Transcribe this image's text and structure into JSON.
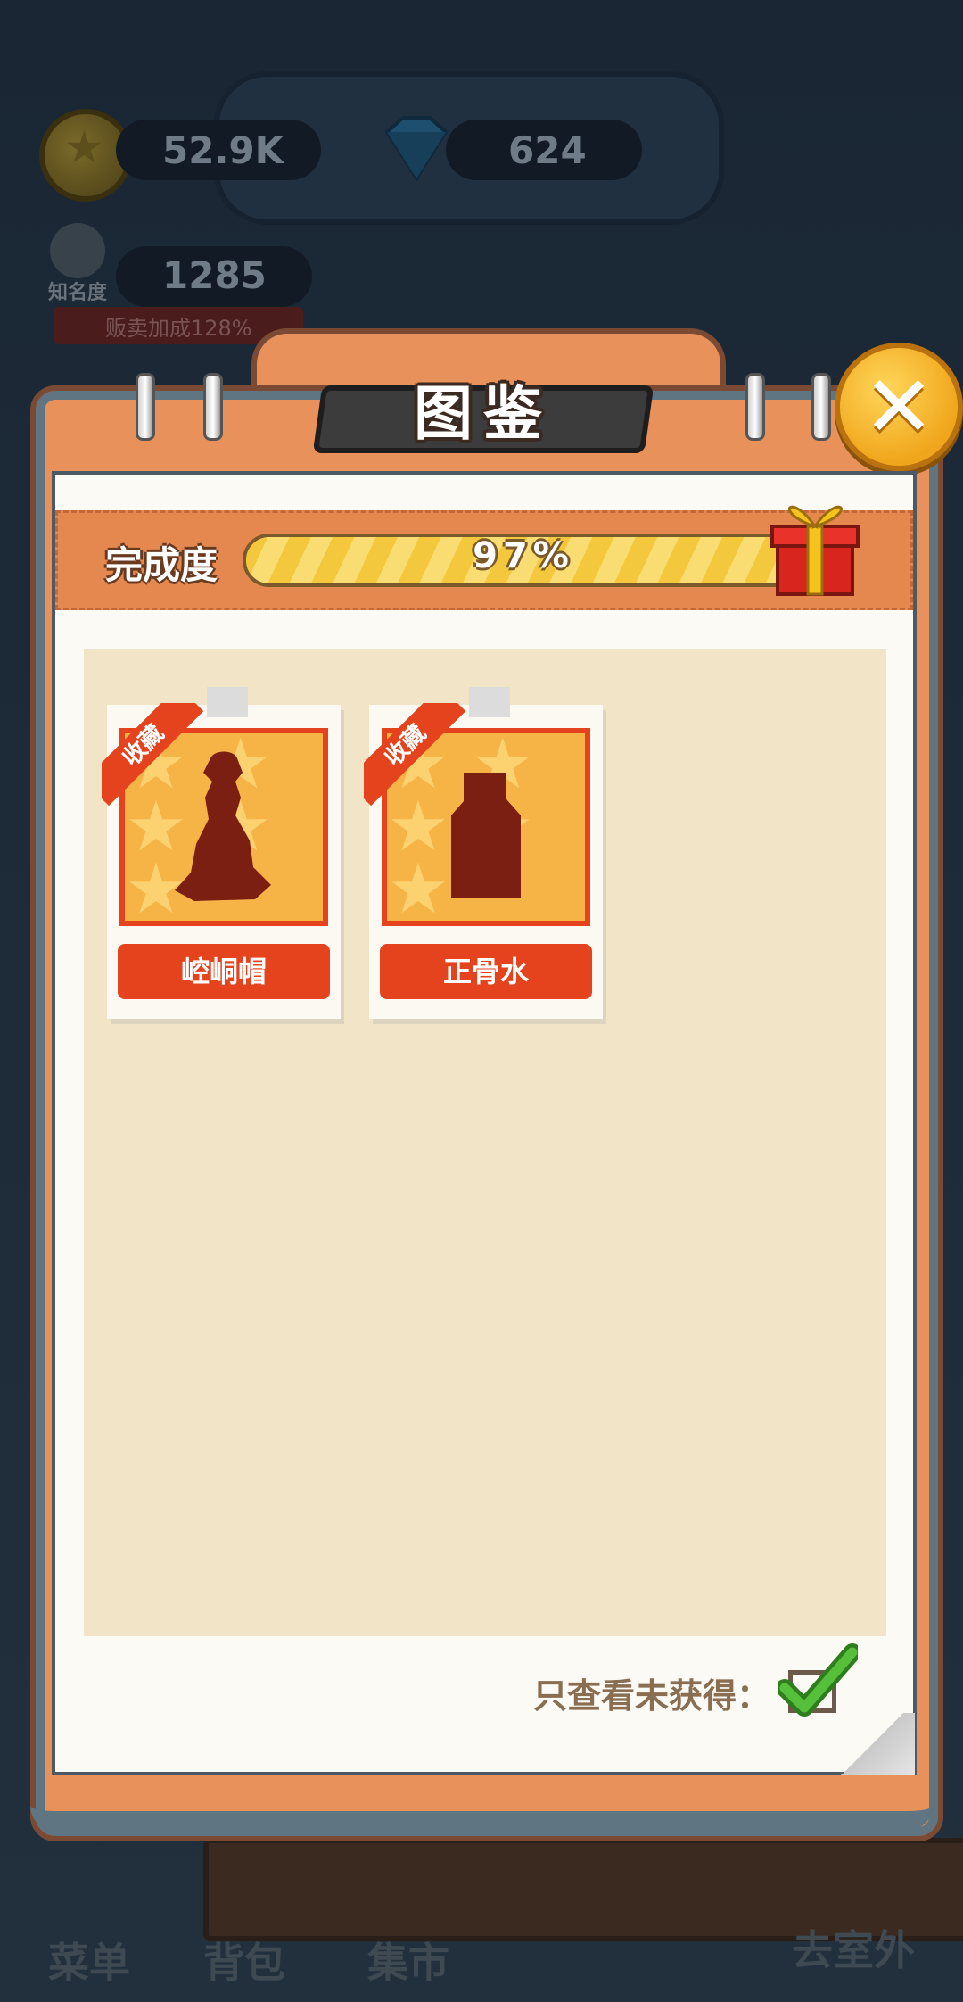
{
  "hud": {
    "coins": "52.9K",
    "gems": "624",
    "fame_label": "知名度",
    "fame_value": "1285",
    "sale_bonus": "贩卖加成128%"
  },
  "dialog": {
    "title": "图鉴",
    "close_icon": "close-icon",
    "progress": {
      "label": "完成度",
      "value_text": "97%",
      "fraction": 0.97
    },
    "items": [
      {
        "ribbon": "收藏",
        "name": "崆峒帽",
        "shape": "hat-silhouette"
      },
      {
        "ribbon": "收藏",
        "name": "正骨水",
        "shape": "bottle-silhouette"
      }
    ],
    "filter": {
      "label": "只查看未获得：",
      "checked": true
    }
  },
  "bottom_nav": {
    "menu": "菜单",
    "bag": "背包",
    "market": "集市",
    "outdoor": "去室外"
  },
  "colors": {
    "accent_orange": "#e9915a",
    "item_red": "#e4431e",
    "check_green": "#3aa12a"
  }
}
